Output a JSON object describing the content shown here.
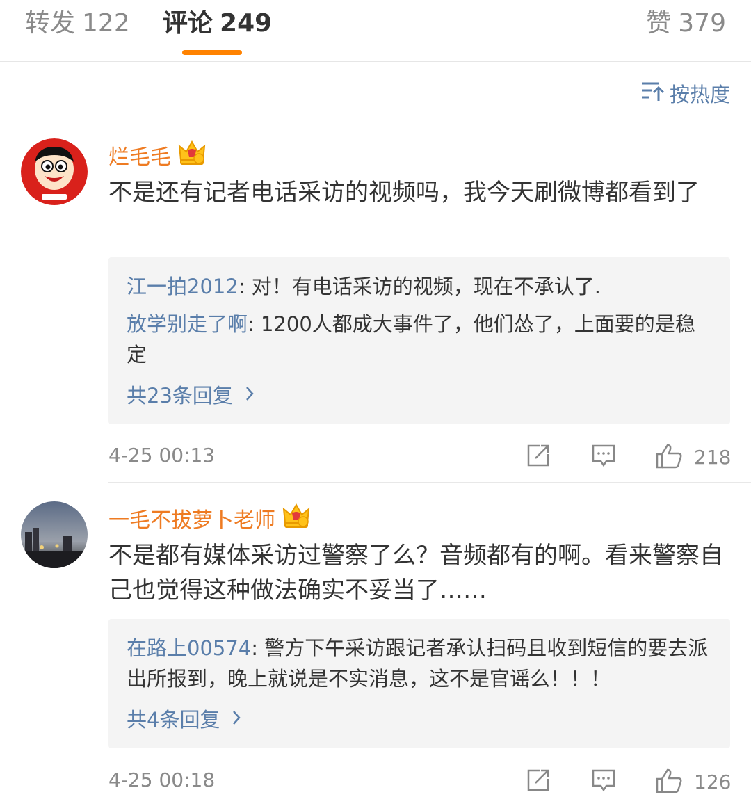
{
  "tabs": {
    "repost": {
      "label": "转发",
      "count": "122"
    },
    "comment": {
      "label": "评论",
      "count": "249"
    },
    "like": {
      "label": "赞",
      "count": "379"
    }
  },
  "sort": {
    "label": "按热度",
    "icon": "sort-icon"
  },
  "accent_color": "#ff8200",
  "link_color": "#5a7eaa",
  "comments": [
    {
      "username": "烂毛毛",
      "text": "不是还有记者电话采访的视频吗，我今天刷微博都看到了",
      "replies": [
        {
          "user": "江一拍2012",
          "text": ": 对！有电话采访的视频，现在不承认了."
        },
        {
          "user": "放学别走了啊",
          "text": ": 1200人都成大事件了，他们怂了，上面要的是稳定"
        }
      ],
      "more_replies": "共23条回复",
      "time": "4-25 00:13",
      "likes": "218"
    },
    {
      "username": "一毛不拔萝卜老师",
      "text": "不是都有媒体采访过警察了么？音频都有的啊。看来警察自己也觉得这种做法确实不妥当了……",
      "replies": [
        {
          "user": "在路上00574",
          "text": ": 警方下午采访跟记者承认扫码且收到短信的要去派出所报到，晚上就说是不实消息，这不是官谣么！！！"
        }
      ],
      "more_replies": "共4条回复",
      "time": "4-25 00:18",
      "likes": "126"
    }
  ]
}
